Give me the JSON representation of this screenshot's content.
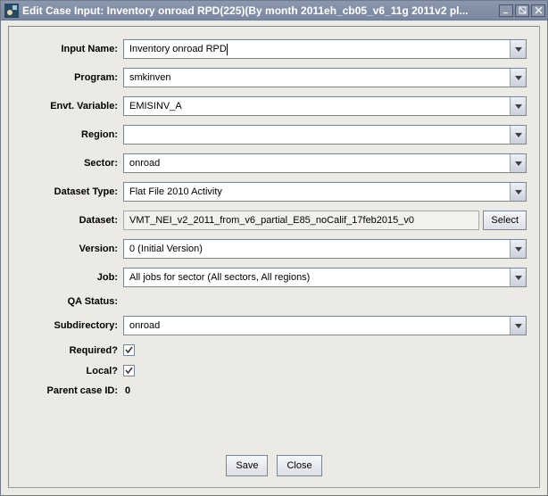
{
  "window": {
    "title": "Edit Case Input: Inventory onroad RPD(225)(By month 2011eh_cb05_v6_11g 2011v2 pl..."
  },
  "labels": {
    "inputName": "Input Name:",
    "program": "Program:",
    "envtVariable": "Envt. Variable:",
    "region": "Region:",
    "sector": "Sector:",
    "datasetType": "Dataset Type:",
    "dataset": "Dataset:",
    "version": "Version:",
    "job": "Job:",
    "qaStatus": "QA Status:",
    "subdirectory": "Subdirectory:",
    "required": "Required?",
    "local": "Local?",
    "parentCaseId": "Parent case ID:"
  },
  "values": {
    "inputName": "Inventory onroad RPD",
    "program": "smkinven",
    "envtVariable": "EMISINV_A",
    "region": "",
    "sector": "onroad",
    "datasetType": "Flat File 2010 Activity",
    "dataset": "VMT_NEI_v2_2011_from_v6_partial_E85_noCalif_17feb2015_v0",
    "version": "0 (Initial Version)",
    "job": "All jobs for sector (All sectors, All regions)",
    "qaStatus": "",
    "subdirectory": "onroad",
    "parentCaseId": "0"
  },
  "checked": {
    "required": true,
    "local": true
  },
  "buttons": {
    "select": "Select",
    "save": "Save",
    "close": "Close"
  }
}
